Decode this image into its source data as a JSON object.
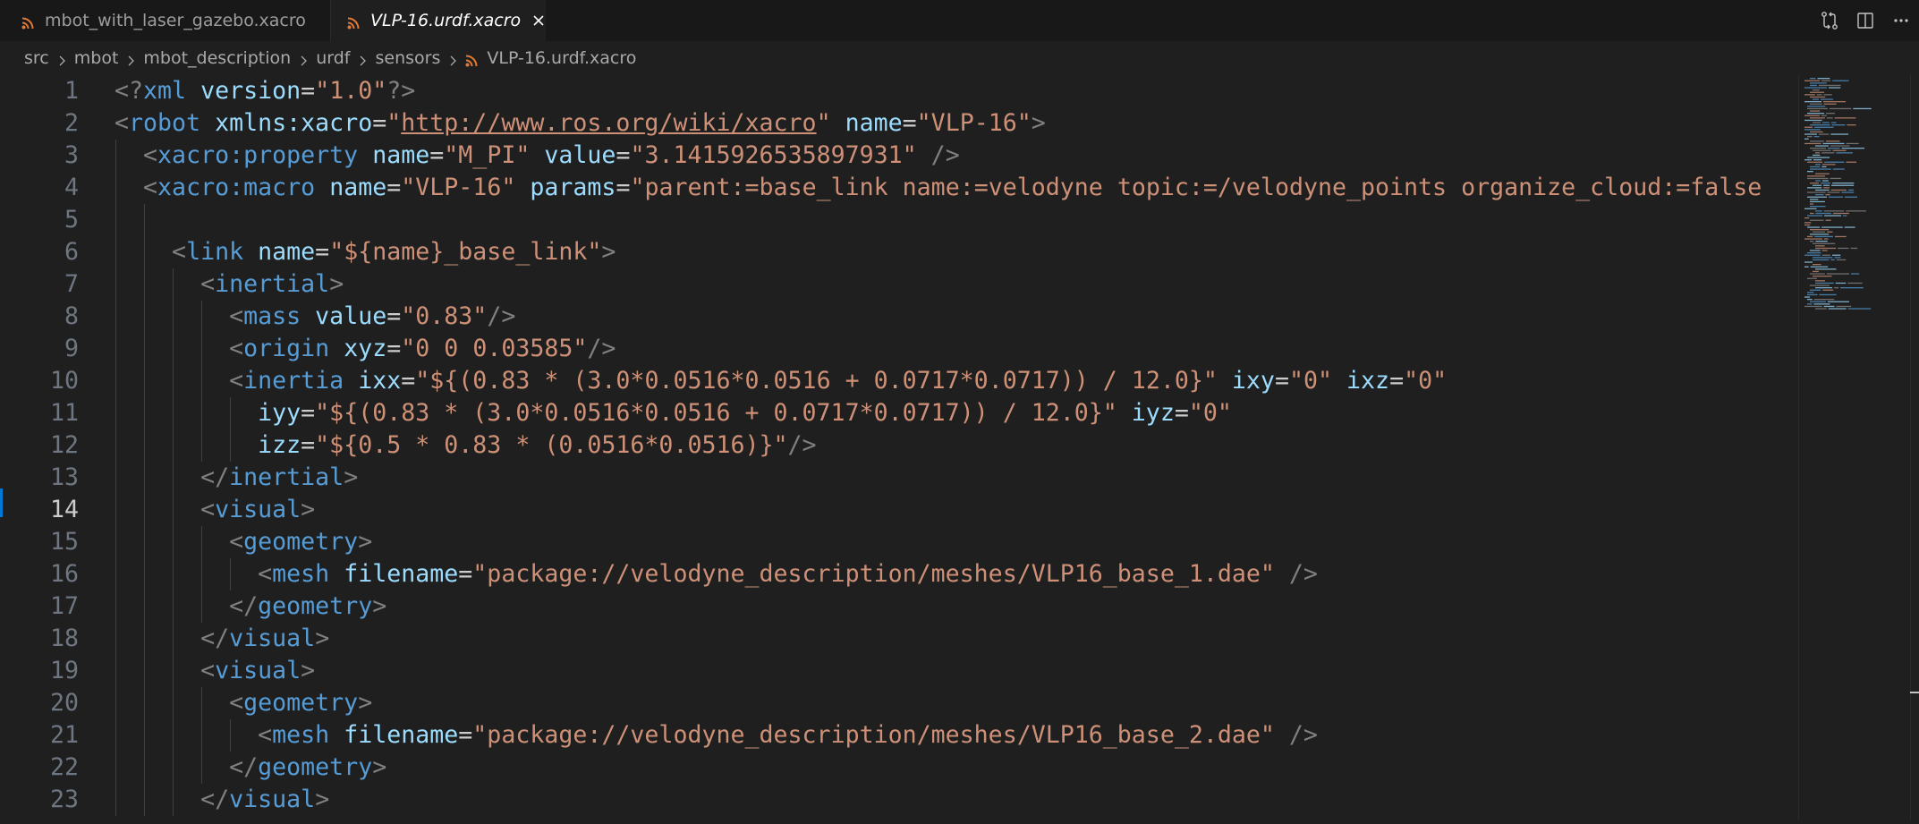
{
  "tabs": [
    {
      "label": "mbot_with_laser_gazebo.xacro",
      "active": false
    },
    {
      "label": "VLP-16.urdf.xacro",
      "active": true
    }
  ],
  "breadcrumb": [
    "src",
    "mbot",
    "mbot_description",
    "urdf",
    "sensors",
    "VLP-16.urdf.xacro"
  ],
  "icons": {
    "tab_file": "rss-file-icon",
    "close": "close-icon",
    "compare": "compare-changes-icon",
    "split": "split-editor-icon",
    "more": "more-actions-icon",
    "separator": "chevron-right-icon"
  },
  "colors": {
    "accent": "#0078d4",
    "tag": "#569cd6",
    "attribute": "#9cdcfe",
    "string": "#ce9178",
    "bracket": "#808080",
    "file_icon": "#e37933"
  },
  "editor": {
    "active_line": 14,
    "lines": [
      {
        "n": "1",
        "tokens": [
          {
            "t": "<?",
            "k": "br"
          },
          {
            "t": "xml",
            "k": "tag"
          },
          {
            "t": " ",
            "k": "pl"
          },
          {
            "t": "version",
            "k": "at"
          },
          {
            "t": "=",
            "k": "pl"
          },
          {
            "t": "\"1.0\"",
            "k": "st"
          },
          {
            "t": "?>",
            "k": "br"
          }
        ]
      },
      {
        "n": "2",
        "tokens": [
          {
            "t": "<",
            "k": "br"
          },
          {
            "t": "robot",
            "k": "tag"
          },
          {
            "t": " ",
            "k": "pl"
          },
          {
            "t": "xmlns:xacro",
            "k": "at"
          },
          {
            "t": "=",
            "k": "pl"
          },
          {
            "t": "\"",
            "k": "st"
          },
          {
            "t": "http://www.ros.org/wiki/xacro",
            "k": "st",
            "u": true
          },
          {
            "t": "\"",
            "k": "st"
          },
          {
            "t": " ",
            "k": "pl"
          },
          {
            "t": "name",
            "k": "at"
          },
          {
            "t": "=",
            "k": "pl"
          },
          {
            "t": "\"VLP-16\"",
            "k": "st"
          },
          {
            "t": ">",
            "k": "br"
          }
        ]
      },
      {
        "n": "3",
        "tokens": [
          {
            "t": "  ",
            "k": "pl"
          },
          {
            "t": "<",
            "k": "br"
          },
          {
            "t": "xacro:property",
            "k": "tag"
          },
          {
            "t": " ",
            "k": "pl"
          },
          {
            "t": "name",
            "k": "at"
          },
          {
            "t": "=",
            "k": "pl"
          },
          {
            "t": "\"M_PI\"",
            "k": "st"
          },
          {
            "t": " ",
            "k": "pl"
          },
          {
            "t": "value",
            "k": "at"
          },
          {
            "t": "=",
            "k": "pl"
          },
          {
            "t": "\"3.1415926535897931\"",
            "k": "st"
          },
          {
            "t": " />",
            "k": "br"
          }
        ]
      },
      {
        "n": "4",
        "tokens": [
          {
            "t": "  ",
            "k": "pl"
          },
          {
            "t": "<",
            "k": "br"
          },
          {
            "t": "xacro:macro",
            "k": "tag"
          },
          {
            "t": " ",
            "k": "pl"
          },
          {
            "t": "name",
            "k": "at"
          },
          {
            "t": "=",
            "k": "pl"
          },
          {
            "t": "\"VLP-16\"",
            "k": "st"
          },
          {
            "t": " ",
            "k": "pl"
          },
          {
            "t": "params",
            "k": "at"
          },
          {
            "t": "=",
            "k": "pl"
          },
          {
            "t": "\"parent:=base_link name:=velodyne topic:=/velodyne_points organize_cloud:=false",
            "k": "st"
          }
        ]
      },
      {
        "n": "5",
        "tokens": []
      },
      {
        "n": "6",
        "tokens": [
          {
            "t": "    ",
            "k": "pl"
          },
          {
            "t": "<",
            "k": "br"
          },
          {
            "t": "link",
            "k": "tag"
          },
          {
            "t": " ",
            "k": "pl"
          },
          {
            "t": "name",
            "k": "at"
          },
          {
            "t": "=",
            "k": "pl"
          },
          {
            "t": "\"${name}_base_link\"",
            "k": "st"
          },
          {
            "t": ">",
            "k": "br"
          }
        ]
      },
      {
        "n": "7",
        "tokens": [
          {
            "t": "      ",
            "k": "pl"
          },
          {
            "t": "<",
            "k": "br"
          },
          {
            "t": "inertial",
            "k": "tag"
          },
          {
            "t": ">",
            "k": "br"
          }
        ]
      },
      {
        "n": "8",
        "tokens": [
          {
            "t": "        ",
            "k": "pl"
          },
          {
            "t": "<",
            "k": "br"
          },
          {
            "t": "mass",
            "k": "tag"
          },
          {
            "t": " ",
            "k": "pl"
          },
          {
            "t": "value",
            "k": "at"
          },
          {
            "t": "=",
            "k": "pl"
          },
          {
            "t": "\"0.83\"",
            "k": "st"
          },
          {
            "t": "/>",
            "k": "br"
          }
        ]
      },
      {
        "n": "9",
        "tokens": [
          {
            "t": "        ",
            "k": "pl"
          },
          {
            "t": "<",
            "k": "br"
          },
          {
            "t": "origin",
            "k": "tag"
          },
          {
            "t": " ",
            "k": "pl"
          },
          {
            "t": "xyz",
            "k": "at"
          },
          {
            "t": "=",
            "k": "pl"
          },
          {
            "t": "\"0 0 0.03585\"",
            "k": "st"
          },
          {
            "t": "/>",
            "k": "br"
          }
        ]
      },
      {
        "n": "10",
        "tokens": [
          {
            "t": "        ",
            "k": "pl"
          },
          {
            "t": "<",
            "k": "br"
          },
          {
            "t": "inertia",
            "k": "tag"
          },
          {
            "t": " ",
            "k": "pl"
          },
          {
            "t": "ixx",
            "k": "at"
          },
          {
            "t": "=",
            "k": "pl"
          },
          {
            "t": "\"${(0.83 * (3.0*0.0516*0.0516 + 0.0717*0.0717)) / 12.0}\"",
            "k": "st"
          },
          {
            "t": " ",
            "k": "pl"
          },
          {
            "t": "ixy",
            "k": "at"
          },
          {
            "t": "=",
            "k": "pl"
          },
          {
            "t": "\"0\"",
            "k": "st"
          },
          {
            "t": " ",
            "k": "pl"
          },
          {
            "t": "ixz",
            "k": "at"
          },
          {
            "t": "=",
            "k": "pl"
          },
          {
            "t": "\"0\"",
            "k": "st"
          }
        ]
      },
      {
        "n": "11",
        "tokens": [
          {
            "t": "          ",
            "k": "pl"
          },
          {
            "t": "iyy",
            "k": "at"
          },
          {
            "t": "=",
            "k": "pl"
          },
          {
            "t": "\"${(0.83 * (3.0*0.0516*0.0516 + 0.0717*0.0717)) / 12.0}\"",
            "k": "st"
          },
          {
            "t": " ",
            "k": "pl"
          },
          {
            "t": "iyz",
            "k": "at"
          },
          {
            "t": "=",
            "k": "pl"
          },
          {
            "t": "\"0\"",
            "k": "st"
          }
        ]
      },
      {
        "n": "12",
        "tokens": [
          {
            "t": "          ",
            "k": "pl"
          },
          {
            "t": "izz",
            "k": "at"
          },
          {
            "t": "=",
            "k": "pl"
          },
          {
            "t": "\"${0.5 * 0.83 * (0.0516*0.0516)}\"",
            "k": "st"
          },
          {
            "t": "/>",
            "k": "br"
          }
        ]
      },
      {
        "n": "13",
        "tokens": [
          {
            "t": "      ",
            "k": "pl"
          },
          {
            "t": "</",
            "k": "br"
          },
          {
            "t": "inertial",
            "k": "tag"
          },
          {
            "t": ">",
            "k": "br"
          }
        ]
      },
      {
        "n": "14",
        "tokens": [
          {
            "t": "      ",
            "k": "pl"
          },
          {
            "t": "<",
            "k": "br"
          },
          {
            "t": "visual",
            "k": "tag"
          },
          {
            "t": ">",
            "k": "br"
          }
        ]
      },
      {
        "n": "15",
        "tokens": [
          {
            "t": "        ",
            "k": "pl"
          },
          {
            "t": "<",
            "k": "br"
          },
          {
            "t": "geometry",
            "k": "tag"
          },
          {
            "t": ">",
            "k": "br"
          }
        ]
      },
      {
        "n": "16",
        "tokens": [
          {
            "t": "          ",
            "k": "pl"
          },
          {
            "t": "<",
            "k": "br"
          },
          {
            "t": "mesh",
            "k": "tag"
          },
          {
            "t": " ",
            "k": "pl"
          },
          {
            "t": "filename",
            "k": "at"
          },
          {
            "t": "=",
            "k": "pl"
          },
          {
            "t": "\"package://velodyne_description/meshes/VLP16_base_1.dae\"",
            "k": "st"
          },
          {
            "t": " />",
            "k": "br"
          }
        ]
      },
      {
        "n": "17",
        "tokens": [
          {
            "t": "        ",
            "k": "pl"
          },
          {
            "t": "</",
            "k": "br"
          },
          {
            "t": "geometry",
            "k": "tag"
          },
          {
            "t": ">",
            "k": "br"
          }
        ]
      },
      {
        "n": "18",
        "tokens": [
          {
            "t": "      ",
            "k": "pl"
          },
          {
            "t": "</",
            "k": "br"
          },
          {
            "t": "visual",
            "k": "tag"
          },
          {
            "t": ">",
            "k": "br"
          }
        ]
      },
      {
        "n": "19",
        "tokens": [
          {
            "t": "      ",
            "k": "pl"
          },
          {
            "t": "<",
            "k": "br"
          },
          {
            "t": "visual",
            "k": "tag"
          },
          {
            "t": ">",
            "k": "br"
          }
        ]
      },
      {
        "n": "20",
        "tokens": [
          {
            "t": "        ",
            "k": "pl"
          },
          {
            "t": "<",
            "k": "br"
          },
          {
            "t": "geometry",
            "k": "tag"
          },
          {
            "t": ">",
            "k": "br"
          }
        ]
      },
      {
        "n": "21",
        "tokens": [
          {
            "t": "          ",
            "k": "pl"
          },
          {
            "t": "<",
            "k": "br"
          },
          {
            "t": "mesh",
            "k": "tag"
          },
          {
            "t": " ",
            "k": "pl"
          },
          {
            "t": "filename",
            "k": "at"
          },
          {
            "t": "=",
            "k": "pl"
          },
          {
            "t": "\"package://velodyne_description/meshes/VLP16_base_2.dae\"",
            "k": "st"
          },
          {
            "t": " />",
            "k": "br"
          }
        ]
      },
      {
        "n": "22",
        "tokens": [
          {
            "t": "        ",
            "k": "pl"
          },
          {
            "t": "</",
            "k": "br"
          },
          {
            "t": "geometry",
            "k": "tag"
          },
          {
            "t": ">",
            "k": "br"
          }
        ]
      },
      {
        "n": "23",
        "tokens": [
          {
            "t": "      ",
            "k": "pl"
          },
          {
            "t": "</",
            "k": "br"
          },
          {
            "t": "visual",
            "k": "tag"
          },
          {
            "t": ">",
            "k": "br"
          }
        ]
      }
    ]
  }
}
